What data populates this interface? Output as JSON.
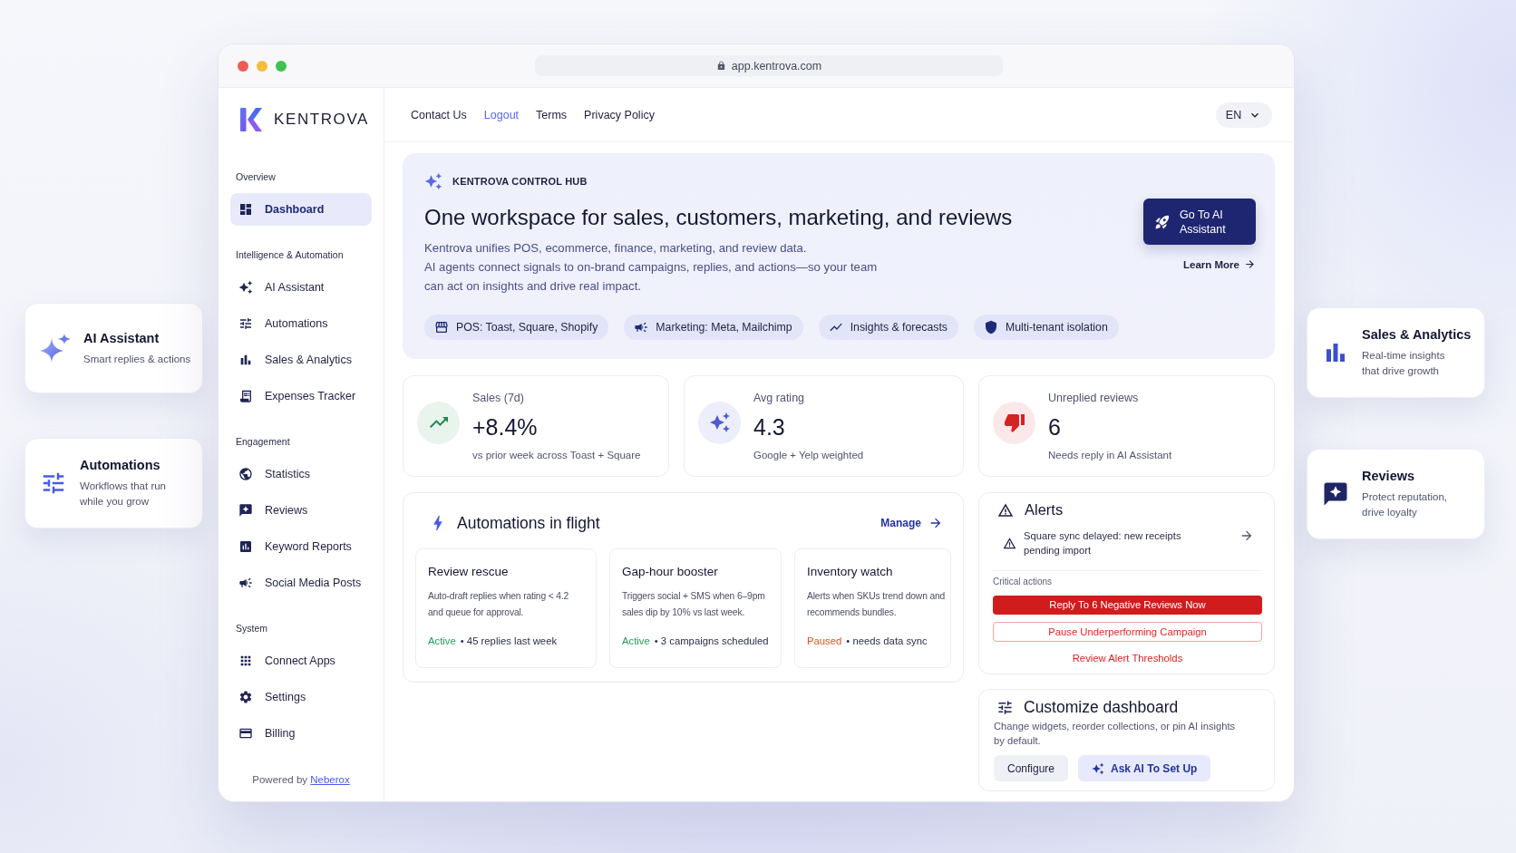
{
  "browser": {
    "url": "app.kentrova.com"
  },
  "brand": {
    "name": "KENTROVA"
  },
  "sidebar": {
    "sections": [
      {
        "title": "Overview",
        "items": [
          {
            "label": "Dashboard",
            "selected": true
          }
        ]
      },
      {
        "title": "Intelligence & Automation",
        "items": [
          {
            "label": "AI Assistant",
            "selected": false
          },
          {
            "label": "Automations",
            "selected": false
          },
          {
            "label": "Sales & Analytics",
            "selected": false
          },
          {
            "label": "Expenses Tracker",
            "selected": false
          }
        ]
      },
      {
        "title": "Engagement",
        "items": [
          {
            "label": "Statistics",
            "selected": false
          },
          {
            "label": "Reviews",
            "selected": false
          },
          {
            "label": "Keyword Reports",
            "selected": false
          },
          {
            "label": "Social Media Posts",
            "selected": false
          }
        ]
      },
      {
        "title": "System",
        "items": [
          {
            "label": "Connect Apps",
            "selected": false
          },
          {
            "label": "Settings",
            "selected": false
          },
          {
            "label": "Billing",
            "selected": false
          }
        ]
      }
    ],
    "footer": {
      "text": "Powered by",
      "link": "Neberox"
    }
  },
  "top_nav": {
    "links": [
      {
        "label": "Contact Us",
        "selected": false
      },
      {
        "label": "Logout",
        "selected": true
      },
      {
        "label": "Terms",
        "selected": false
      },
      {
        "label": "Privacy Policy",
        "selected": false
      }
    ],
    "language": "EN"
  },
  "hero": {
    "eyebrow": "KENTROVA CONTROL HUB",
    "title": "One workspace for sales, customers, marketing, and reviews",
    "description": "Kentrova unifies POS, ecommerce, finance, marketing, and review data.\nAI agents connect signals to on-brand campaigns, replies, and actions—so your team\ncan act on insights and drive real impact.",
    "chips": [
      "POS: Toast, Square, Shopify",
      "Marketing: Meta, Mailchimp",
      "Insights & forecasts",
      "Multi-tenant isolation"
    ],
    "primary_action": "Go To AI\nAssistant",
    "secondary_action": "Learn More"
  },
  "stats": [
    {
      "kind": "up",
      "label": "Sales (7d)",
      "value": "+8.4%",
      "note": "vs prior week across Toast + Square"
    },
    {
      "kind": "rating",
      "label": "Avg rating",
      "value": "4.3",
      "note": "Google + Yelp weighted"
    },
    {
      "kind": "down",
      "label": "Unreplied reviews",
      "value": "6",
      "note": "Needs reply in AI Assistant"
    }
  ],
  "automations": {
    "title": "Automations in flight",
    "action": "Manage",
    "items": [
      {
        "title": "Review rescue",
        "description": "Auto-draft replies when rating < 4.2\nand queue for approval.",
        "status": "Active",
        "paused": false,
        "detail": "• 45 replies last week"
      },
      {
        "title": "Gap-hour booster",
        "description": "Triggers social + SMS when 6–9pm\nsales dip by 10% vs last week.",
        "status": "Active",
        "paused": false,
        "detail": "• 3 campaigns scheduled"
      },
      {
        "title": "Inventory watch",
        "description": "Alerts when SKUs trend down and\nrecommends bundles.",
        "status": "Paused",
        "paused": true,
        "detail": "• needs data sync"
      }
    ]
  },
  "alerts": {
    "title": "Alerts",
    "items": [
      {
        "text": "Square sync delayed: new receipts\npending import"
      }
    ],
    "actions_label": "Critical actions",
    "actions": [
      {
        "kind": "primary",
        "label": "Reply To 6 Negative Reviews Now"
      },
      {
        "kind": "outline",
        "label": "Pause Underperforming Campaign"
      },
      {
        "kind": "link",
        "label": "Review Alert Thresholds"
      }
    ]
  },
  "customize": {
    "title": "Customize dashboard",
    "description": "Change widgets, reorder collections, or pin AI insights\nby default.",
    "buttons": [
      {
        "kind": "secondary",
        "label": "Configure"
      },
      {
        "kind": "ai",
        "label": "Ask AI To Set Up"
      }
    ]
  },
  "feature_cards": {
    "left": [
      {
        "title": "AI Assistant",
        "description": "Smart replies & actions"
      },
      {
        "title": "Automations",
        "description": "Workflows that run\nwhile you grow"
      }
    ],
    "right": [
      {
        "title": "Sales & Analytics",
        "description": "Real-time insights\nthat drive growth"
      },
      {
        "title": "Reviews",
        "description": "Protect reputation,\ndrive loyalty"
      }
    ]
  }
}
